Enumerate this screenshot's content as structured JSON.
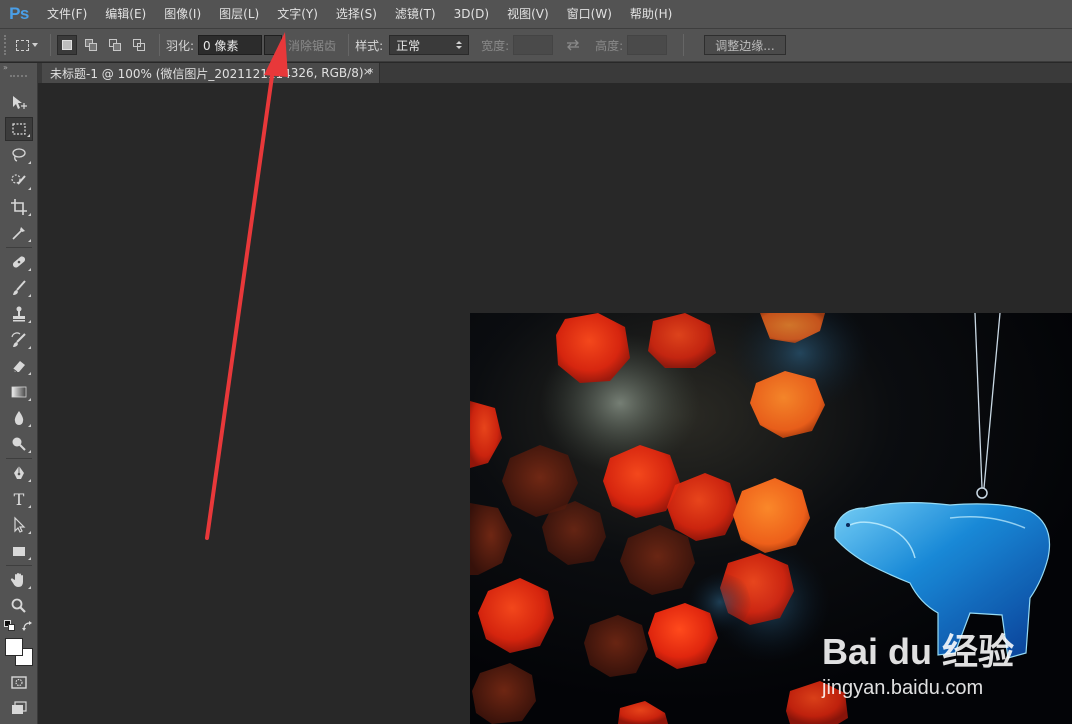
{
  "app": {
    "logo": "Ps"
  },
  "menu": {
    "items": [
      "文件(F)",
      "编辑(E)",
      "图像(I)",
      "图层(L)",
      "文字(Y)",
      "选择(S)",
      "滤镜(T)",
      "3D(D)",
      "视图(V)",
      "窗口(W)",
      "帮助(H)"
    ]
  },
  "options": {
    "feather_label": "羽化:",
    "feather_value": "0 像素",
    "antialias_label": "消除锯齿",
    "style_label": "样式:",
    "style_value": "正常",
    "width_label": "宽度:",
    "width_value": "",
    "height_label": "高度:",
    "height_value": "",
    "refine_edge_label": "调整边缘..."
  },
  "document": {
    "tab_title": "未标题-1 @ 100% (微信图片_2021121114",
    "tab_title_tail": "326, RGB/8) *",
    "close_glyph": "×"
  },
  "image": {
    "watermark_text": "Bai du 经验",
    "watermark_url": "jingyan.baidu.com"
  },
  "colors": {
    "accent_logo": "#4a9fe8",
    "annotation_arrow": "#e8383a"
  },
  "toolbox": {
    "collapse_glyph": "»",
    "tools": [
      "move-icon",
      "rect-marquee-icon",
      "lasso-icon",
      "quick-select-icon",
      "crop-icon",
      "eyedropper-icon",
      "healing-brush-icon",
      "brush-icon",
      "clone-stamp-icon",
      "history-brush-icon",
      "eraser-icon",
      "gradient-icon",
      "blur-icon",
      "dodge-icon",
      "pen-icon",
      "type-icon",
      "path-select-icon",
      "rectangle-shape-icon",
      "hand-icon",
      "zoom-icon"
    ],
    "type_glyph": "T"
  }
}
